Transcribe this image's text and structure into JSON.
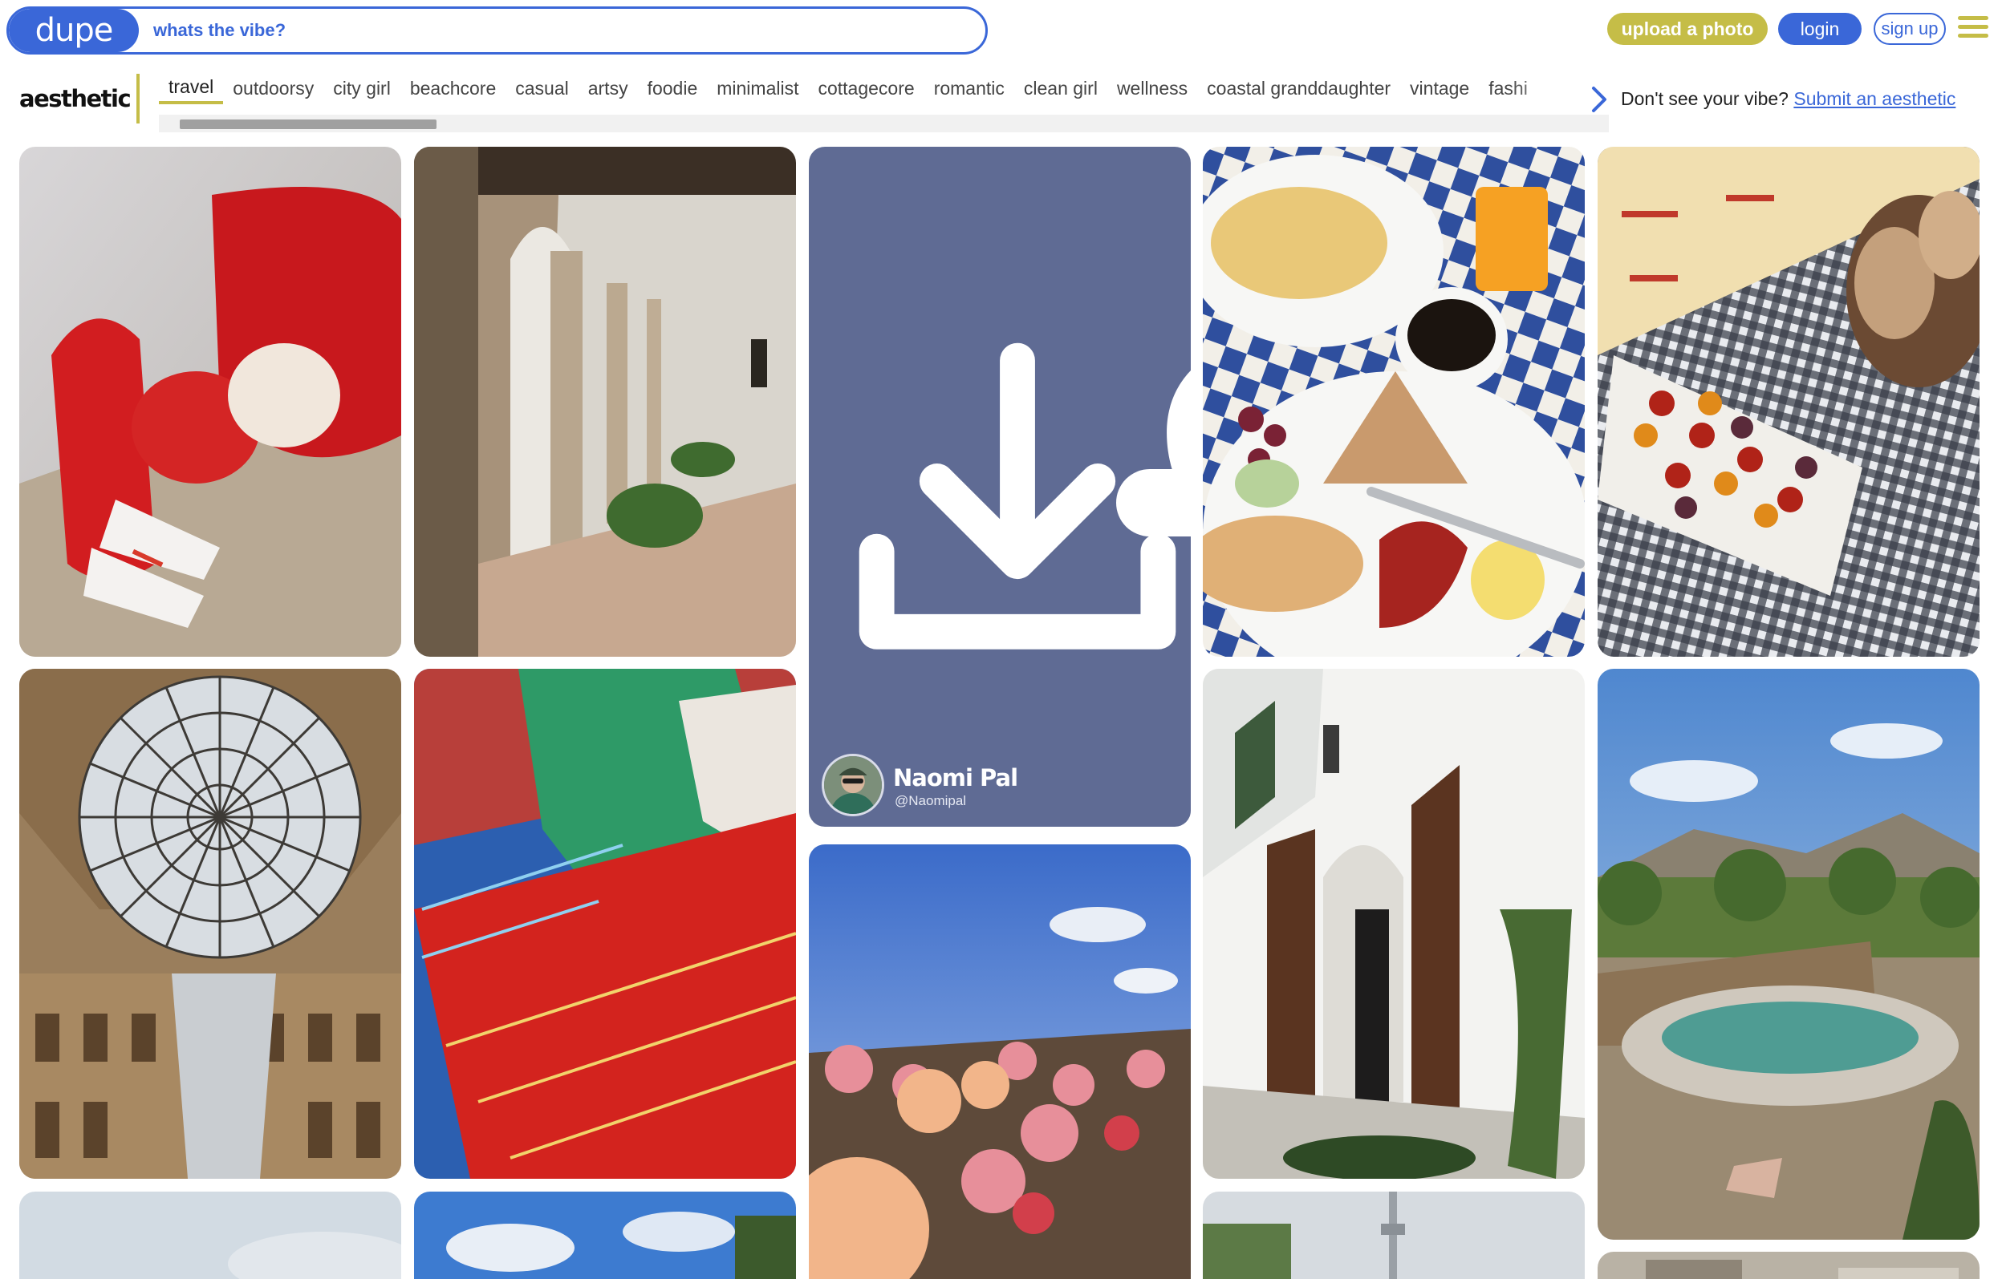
{
  "header": {
    "logo": "dupe",
    "search_placeholder": "whats the vibe?",
    "upload_label": "upload a photo",
    "login_label": "login",
    "signup_label": "sign up",
    "menu_icon": "hamburger-icon"
  },
  "tagbar": {
    "label": "aesthetic",
    "active": "travel",
    "tags": [
      "travel",
      "outdoorsy",
      "city girl",
      "beachcore",
      "casual",
      "artsy",
      "foodie",
      "minimalist",
      "cottagecore",
      "romantic",
      "clean girl",
      "wellness",
      "coastal granddaughter",
      "vintage",
      "fashi"
    ],
    "submit_prompt": "Don't see your vibe?",
    "submit_link": "Submit an aesthetic"
  },
  "profile_card": {
    "name": "Naomi Pal",
    "handle": "@Naomipal",
    "icons": [
      "download-icon",
      "plus-icon",
      "heart-icon"
    ]
  },
  "colors": {
    "brand_blue": "#3a67d8",
    "accent_olive": "#c5bd47",
    "profile_bg": "#5f6b94"
  }
}
